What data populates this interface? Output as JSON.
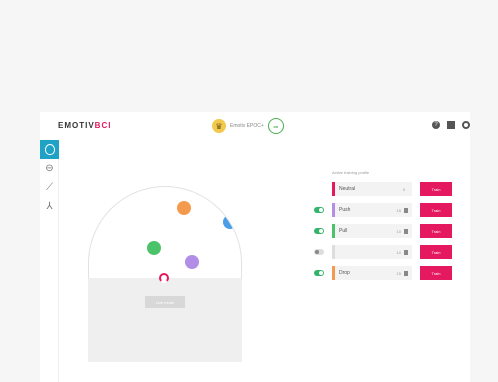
{
  "app": {
    "logo_text": "EMOTIV",
    "logo_accent": "BCI",
    "brand_color": "#e5195f"
  },
  "device": {
    "name": "Emotiv EPOC+",
    "status_text": "on"
  },
  "top_icons": [
    "help-icon",
    "flag-icon",
    "gear-icon"
  ],
  "sidebar": {
    "items": [
      {
        "name": "brain-icon",
        "active": true
      },
      {
        "name": "helmet-icon",
        "active": false
      },
      {
        "name": "graph-icon",
        "active": false
      },
      {
        "name": "network-icon",
        "active": false
      }
    ]
  },
  "stage": {
    "live_button": "Live mode",
    "dots": [
      {
        "color": "#f39a4e"
      },
      {
        "color": "#4a9ee8"
      },
      {
        "color": "#4cc36a"
      },
      {
        "color": "#b38ee6"
      }
    ]
  },
  "panel": {
    "title": "Active training profile",
    "rows": [
      {
        "toggle": "none",
        "name": "Neutral",
        "level": "0",
        "color": "#e5195f",
        "train": "Train",
        "trash": false
      },
      {
        "toggle": "on",
        "name": "Push",
        "level": "15",
        "color": "#b38ee6",
        "train": "Train",
        "trash": true
      },
      {
        "toggle": "on",
        "name": "Pull",
        "level": "10",
        "color": "#4cc36a",
        "train": "Train",
        "trash": true
      },
      {
        "toggle": "off",
        "name": "",
        "level": "10",
        "color": "#dddddd",
        "train": "Train",
        "trash": true
      },
      {
        "toggle": "on",
        "name": "Drop",
        "level": "15",
        "color": "#f39a4e",
        "train": "Train",
        "trash": true
      }
    ]
  }
}
